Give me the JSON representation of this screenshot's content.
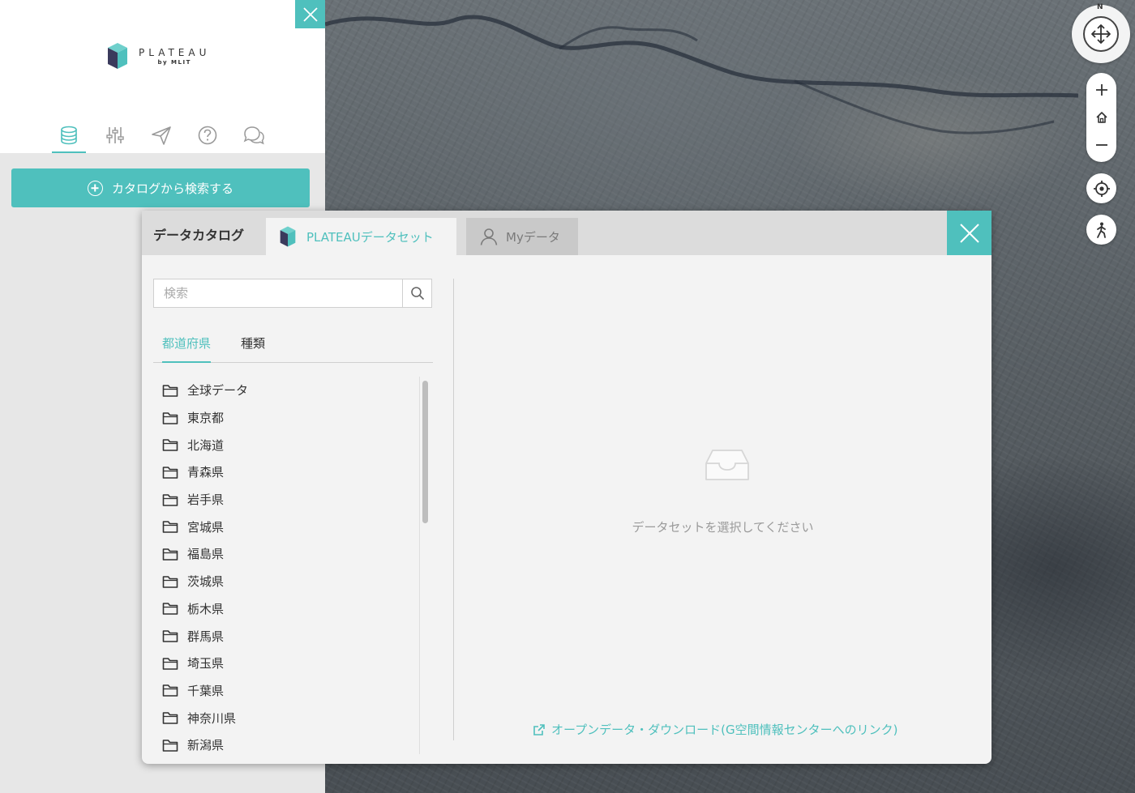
{
  "colors": {
    "accent": "#4fc0bd",
    "logo_dark": "#3a3a5c",
    "logo_teal": "#4fc0bd"
  },
  "logo": {
    "word": "PLATEAU",
    "sub": "by MLIT"
  },
  "sidebar": {
    "close_icon": "close-icon",
    "menu_tabs": [
      {
        "name": "data",
        "icon": "database-icon",
        "active": true
      },
      {
        "name": "settings",
        "icon": "sliders-icon",
        "active": false
      },
      {
        "name": "share",
        "icon": "send-icon",
        "active": false
      },
      {
        "name": "help",
        "icon": "help-icon",
        "active": false
      },
      {
        "name": "feedback",
        "icon": "chat-icon",
        "active": false
      }
    ],
    "catalog_button_label": "カタログから検索する"
  },
  "map_controls": {
    "compass_label": "N",
    "buttons": [
      "zoom-in-icon",
      "home-icon",
      "zoom-out-icon",
      "locate-icon",
      "pedestrian-icon"
    ]
  },
  "modal": {
    "title": "データカタログ",
    "tabs": [
      {
        "label": "PLATEAUデータセット",
        "active": true,
        "icon": "plateau-logo-icon"
      },
      {
        "label": "Myデータ",
        "active": false,
        "icon": "user-icon"
      }
    ],
    "search": {
      "placeholder": "検索",
      "value": ""
    },
    "filter_tabs": [
      {
        "label": "都道府県",
        "active": true
      },
      {
        "label": "種類",
        "active": false
      }
    ],
    "folders": [
      "全球データ",
      "東京都",
      "北海道",
      "青森県",
      "岩手県",
      "宮城県",
      "福島県",
      "茨城県",
      "栃木県",
      "群馬県",
      "埼玉県",
      "千葉県",
      "神奈川県",
      "新潟県"
    ],
    "empty_message": "データセットを選択してください",
    "download_link": "オープンデータ・ダウンロード(G空間情報センターへのリンク)"
  }
}
